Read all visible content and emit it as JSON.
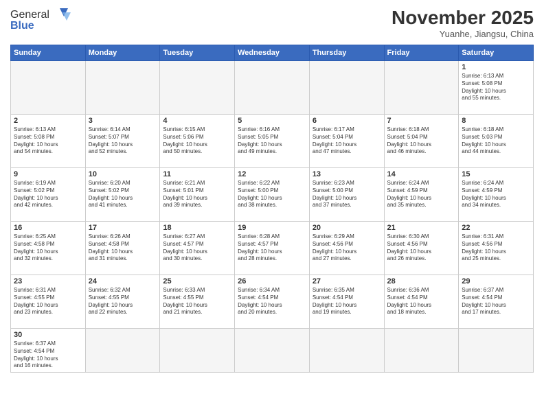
{
  "header": {
    "logo_general": "General",
    "logo_blue": "Blue",
    "month_title": "November 2025",
    "subtitle": "Yuanhe, Jiangsu, China"
  },
  "weekdays": [
    "Sunday",
    "Monday",
    "Tuesday",
    "Wednesday",
    "Thursday",
    "Friday",
    "Saturday"
  ],
  "weeks": [
    [
      {
        "day": "",
        "info": ""
      },
      {
        "day": "",
        "info": ""
      },
      {
        "day": "",
        "info": ""
      },
      {
        "day": "",
        "info": ""
      },
      {
        "day": "",
        "info": ""
      },
      {
        "day": "",
        "info": ""
      },
      {
        "day": "1",
        "info": "Sunrise: 6:13 AM\nSunset: 5:08 PM\nDaylight: 10 hours\nand 55 minutes."
      }
    ],
    [
      {
        "day": "2",
        "info": "Sunrise: 6:13 AM\nSunset: 5:08 PM\nDaylight: 10 hours\nand 54 minutes."
      },
      {
        "day": "3",
        "info": "Sunrise: 6:14 AM\nSunset: 5:07 PM\nDaylight: 10 hours\nand 52 minutes."
      },
      {
        "day": "4",
        "info": "Sunrise: 6:15 AM\nSunset: 5:06 PM\nDaylight: 10 hours\nand 50 minutes."
      },
      {
        "day": "5",
        "info": "Sunrise: 6:16 AM\nSunset: 5:05 PM\nDaylight: 10 hours\nand 49 minutes."
      },
      {
        "day": "6",
        "info": "Sunrise: 6:17 AM\nSunset: 5:04 PM\nDaylight: 10 hours\nand 47 minutes."
      },
      {
        "day": "7",
        "info": "Sunrise: 6:18 AM\nSunset: 5:04 PM\nDaylight: 10 hours\nand 46 minutes."
      },
      {
        "day": "8",
        "info": "Sunrise: 6:18 AM\nSunset: 5:03 PM\nDaylight: 10 hours\nand 44 minutes."
      }
    ],
    [
      {
        "day": "9",
        "info": "Sunrise: 6:19 AM\nSunset: 5:02 PM\nDaylight: 10 hours\nand 42 minutes."
      },
      {
        "day": "10",
        "info": "Sunrise: 6:20 AM\nSunset: 5:02 PM\nDaylight: 10 hours\nand 41 minutes."
      },
      {
        "day": "11",
        "info": "Sunrise: 6:21 AM\nSunset: 5:01 PM\nDaylight: 10 hours\nand 39 minutes."
      },
      {
        "day": "12",
        "info": "Sunrise: 6:22 AM\nSunset: 5:00 PM\nDaylight: 10 hours\nand 38 minutes."
      },
      {
        "day": "13",
        "info": "Sunrise: 6:23 AM\nSunset: 5:00 PM\nDaylight: 10 hours\nand 37 minutes."
      },
      {
        "day": "14",
        "info": "Sunrise: 6:24 AM\nSunset: 4:59 PM\nDaylight: 10 hours\nand 35 minutes."
      },
      {
        "day": "15",
        "info": "Sunrise: 6:24 AM\nSunset: 4:59 PM\nDaylight: 10 hours\nand 34 minutes."
      }
    ],
    [
      {
        "day": "16",
        "info": "Sunrise: 6:25 AM\nSunset: 4:58 PM\nDaylight: 10 hours\nand 32 minutes."
      },
      {
        "day": "17",
        "info": "Sunrise: 6:26 AM\nSunset: 4:58 PM\nDaylight: 10 hours\nand 31 minutes."
      },
      {
        "day": "18",
        "info": "Sunrise: 6:27 AM\nSunset: 4:57 PM\nDaylight: 10 hours\nand 30 minutes."
      },
      {
        "day": "19",
        "info": "Sunrise: 6:28 AM\nSunset: 4:57 PM\nDaylight: 10 hours\nand 28 minutes."
      },
      {
        "day": "20",
        "info": "Sunrise: 6:29 AM\nSunset: 4:56 PM\nDaylight: 10 hours\nand 27 minutes."
      },
      {
        "day": "21",
        "info": "Sunrise: 6:30 AM\nSunset: 4:56 PM\nDaylight: 10 hours\nand 26 minutes."
      },
      {
        "day": "22",
        "info": "Sunrise: 6:31 AM\nSunset: 4:56 PM\nDaylight: 10 hours\nand 25 minutes."
      }
    ],
    [
      {
        "day": "23",
        "info": "Sunrise: 6:31 AM\nSunset: 4:55 PM\nDaylight: 10 hours\nand 23 minutes."
      },
      {
        "day": "24",
        "info": "Sunrise: 6:32 AM\nSunset: 4:55 PM\nDaylight: 10 hours\nand 22 minutes."
      },
      {
        "day": "25",
        "info": "Sunrise: 6:33 AM\nSunset: 4:55 PM\nDaylight: 10 hours\nand 21 minutes."
      },
      {
        "day": "26",
        "info": "Sunrise: 6:34 AM\nSunset: 4:54 PM\nDaylight: 10 hours\nand 20 minutes."
      },
      {
        "day": "27",
        "info": "Sunrise: 6:35 AM\nSunset: 4:54 PM\nDaylight: 10 hours\nand 19 minutes."
      },
      {
        "day": "28",
        "info": "Sunrise: 6:36 AM\nSunset: 4:54 PM\nDaylight: 10 hours\nand 18 minutes."
      },
      {
        "day": "29",
        "info": "Sunrise: 6:37 AM\nSunset: 4:54 PM\nDaylight: 10 hours\nand 17 minutes."
      }
    ],
    [
      {
        "day": "30",
        "info": "Sunrise: 6:37 AM\nSunset: 4:54 PM\nDaylight: 10 hours\nand 16 minutes."
      },
      {
        "day": "",
        "info": ""
      },
      {
        "day": "",
        "info": ""
      },
      {
        "day": "",
        "info": ""
      },
      {
        "day": "",
        "info": ""
      },
      {
        "day": "",
        "info": ""
      },
      {
        "day": "",
        "info": ""
      }
    ]
  ]
}
